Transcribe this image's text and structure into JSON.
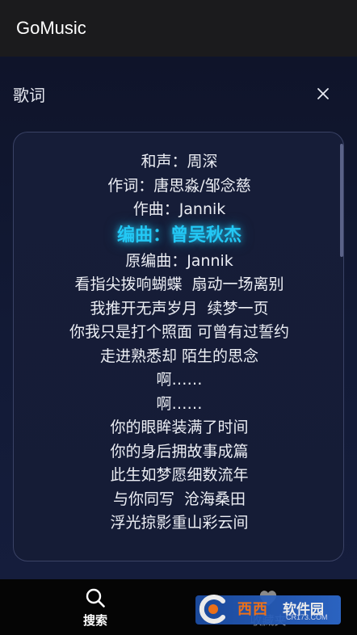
{
  "app": {
    "title": "GoMusic"
  },
  "lyrics_panel": {
    "title": "歌词",
    "close_icon": "close-icon",
    "lines": [
      "和声：周深",
      "作词：唐思淼/邹念慈",
      "作曲：Jannik",
      "编曲：曾吴秋杰",
      "原编曲：Jannik",
      "看指尖拨响蝴蝶  扇动一场离别",
      "我推开无声岁月  续梦一页",
      "你我只是打个照面 可曾有过誓约",
      "走进熟悉却 陌生的思念",
      "啊……",
      "啊……",
      "你的眼眸装满了时间",
      "你的身后拥故事成篇",
      "此生如梦愿细数流年",
      "与你同写  沧海桑田",
      "浮光掠影重山彩云间"
    ],
    "active_line_index": 3,
    "active_color": "#23c8f5"
  },
  "bottom_nav": {
    "items": [
      {
        "label": "搜索",
        "icon": "search-icon"
      },
      {
        "label": "收藏夹",
        "icon": "heart-icon"
      }
    ]
  },
  "watermark": {
    "brand_orange": "西西",
    "brand_white": "软件园",
    "url": "CR173.COM"
  }
}
